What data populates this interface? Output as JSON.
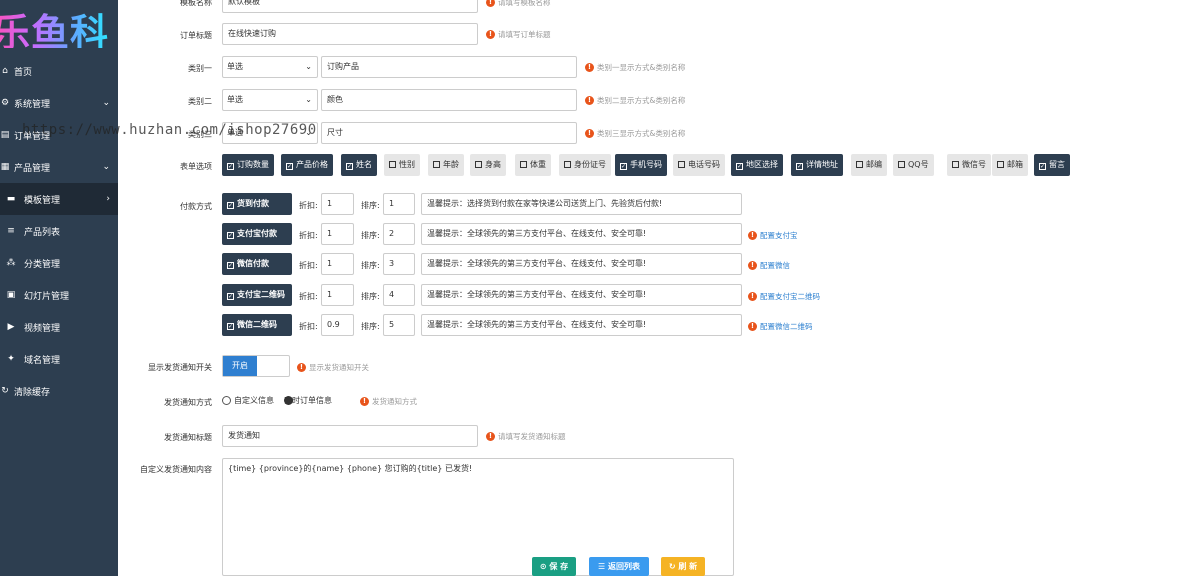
{
  "logo": {
    "text": "乐鱼科"
  },
  "watermark": "https://www.huzhan.com/ishop27690",
  "sidebar": {
    "items": [
      {
        "label": "首页",
        "icon": "home-icon"
      },
      {
        "label": "系统管理",
        "icon": "gear-icon"
      },
      {
        "label": "订单管理",
        "icon": "table-icon"
      },
      {
        "label": "产品管理",
        "icon": "grid-icon"
      },
      {
        "label": "模板管理",
        "icon": "folder-icon"
      },
      {
        "label": "产品列表",
        "icon": "list-icon"
      },
      {
        "label": "分类管理",
        "icon": "sitemap-icon"
      },
      {
        "label": "幻灯片管理",
        "icon": "image-icon"
      },
      {
        "label": "视频管理",
        "icon": "video-icon"
      },
      {
        "label": "域名管理",
        "icon": "link-icon"
      },
      {
        "label": "清除缓存",
        "icon": "refresh-icon"
      }
    ]
  },
  "form": {
    "template_name": {
      "label": "模板名称",
      "value": "默认模板",
      "hint": "请填写模板名称"
    },
    "order_title": {
      "label": "订单标题",
      "value": "在线快速订购",
      "hint": "请填写订单标题"
    },
    "cat1": {
      "label": "类别一",
      "select": "单选",
      "value": "订购产品",
      "hint": "类别一显示方式&类别名称"
    },
    "cat2": {
      "label": "类别二",
      "select": "单选",
      "value": "颜色",
      "hint": "类别二显示方式&类别名称"
    },
    "cat3": {
      "label": "类别三",
      "select": "单选",
      "value": "尺寸",
      "hint": "类别三显示方式&类别名称"
    },
    "options_label": "表单选项",
    "options": [
      {
        "label": "订购数量",
        "checked": true
      },
      {
        "label": "产品价格",
        "checked": true
      },
      {
        "label": "姓名",
        "checked": true
      },
      {
        "label": "性别",
        "checked": false
      },
      {
        "label": "年龄",
        "checked": false
      },
      {
        "label": "身高",
        "checked": false
      },
      {
        "label": "体重",
        "checked": false
      },
      {
        "label": "身份证号",
        "checked": false
      },
      {
        "label": "手机号码",
        "checked": true
      },
      {
        "label": "电话号码",
        "checked": false
      },
      {
        "label": "地区选择",
        "checked": true
      },
      {
        "label": "详情地址",
        "checked": true
      },
      {
        "label": "邮编",
        "checked": false
      },
      {
        "label": "QQ号",
        "checked": false
      },
      {
        "label": "微信号",
        "checked": false
      },
      {
        "label": "邮箱",
        "checked": false
      },
      {
        "label": "留言",
        "checked": true
      }
    ],
    "payment_label": "付款方式",
    "discount_label": "折扣:",
    "sort_label": "排序:",
    "payments": [
      {
        "name": "货到付款",
        "discount": "1",
        "sort": "1",
        "note": "温馨提示：选择货到付款在家等快递公司送货上门、先验货后付款!",
        "link": ""
      },
      {
        "name": "支付宝付款",
        "discount": "1",
        "sort": "2",
        "note": "温馨提示：全球领先的第三方支付平台、在线支付、安全可靠!",
        "link": "配置支付宝"
      },
      {
        "name": "微信付款",
        "discount": "1",
        "sort": "3",
        "note": "温馨提示：全球领先的第三方支付平台、在线支付、安全可靠!",
        "link": "配置微信"
      },
      {
        "name": "支付宝二维码",
        "discount": "1",
        "sort": "4",
        "note": "温馨提示：全球领先的第三方支付平台、在线支付、安全可靠!",
        "link": "配置支付宝二维码"
      },
      {
        "name": "微信二维码",
        "discount": "0.9",
        "sort": "5",
        "note": "温馨提示：全球领先的第三方支付平台、在线支付、安全可靠!",
        "link": "配置微信二维码"
      }
    ],
    "notify_switch": {
      "label": "显示发货通知开关",
      "on_text": "开启",
      "hint": "显示发货通知开关"
    },
    "notify_mode": {
      "label": "发货通知方式",
      "options": [
        "自定义信息",
        "实时订单信息"
      ],
      "selected": 1,
      "hint": "发货通知方式"
    },
    "notify_title": {
      "label": "发货通知标题",
      "value": "发货通知",
      "hint": "请填写发货通知标题"
    },
    "notify_content": {
      "label": "自定义发货通知内容",
      "value": "{time} {province}的{name} {phone} 您订购的{title} 已发货!"
    }
  },
  "buttons": {
    "save": "保 存",
    "back": "返回列表",
    "refresh": "刷 新"
  },
  "colors": {
    "sidebar": "#2d3e50",
    "primary": "#2f7fd0",
    "save": "#1a9f83",
    "back": "#3a9bef",
    "refresh": "#f5b324",
    "warn": "#e8541b"
  }
}
